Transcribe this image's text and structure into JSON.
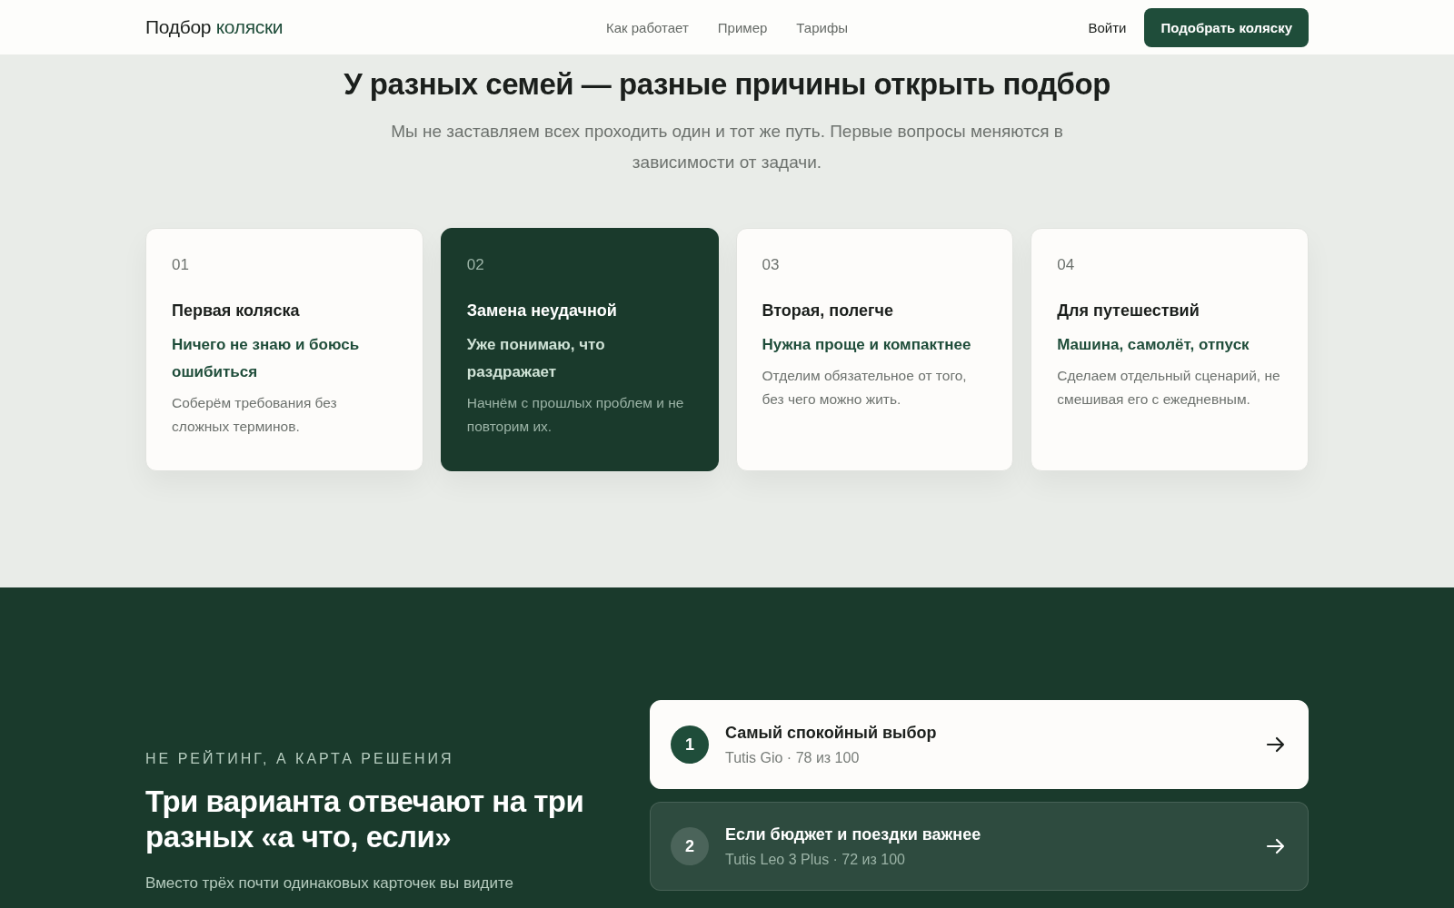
{
  "header": {
    "logo": {
      "part_1": "Подбор",
      "part_2": "коляски"
    },
    "nav": [
      "Как работает",
      "Пример",
      "Тарифы"
    ],
    "login": "Войти",
    "cta": "Подобрать коляску"
  },
  "situations": {
    "title": "У разных семей — разные причины открыть подбор",
    "subtitle": "Мы не заставляем всех проходить один и тот же путь. Первые вопросы меняются в зависимости от задачи.",
    "cards": [
      {
        "number": "01",
        "title": "Первая коляска",
        "quote": "Ничего не знаю и боюсь ошибиться",
        "text": "Соберём требования без сложных терминов.",
        "selected": false
      },
      {
        "number": "02",
        "title": "Замена неудачной",
        "quote": "Уже понимаю, что раздражает",
        "text": "Начнём с прошлых проблем и не повторим их.",
        "selected": true
      },
      {
        "number": "03",
        "title": "Вторая, полегче",
        "quote": "Нужна проще и компактнее",
        "text": "Отделим обязательное от того, без чего можно жить.",
        "selected": false
      },
      {
        "number": "04",
        "title": "Для путешествий",
        "quote": "Машина, самолёт, отпуск",
        "text": "Сделаем отдельный сценарий, не смешивая его с ежедневным.",
        "selected": false
      }
    ]
  },
  "decision": {
    "eyebrow": "НЕ РЕЙТИНГ, А КАРТА РЕШЕНИЯ",
    "title": "Три варианта отвечают на три разных «а что, если»",
    "text": "Вместо трёх почти одинаковых карточек вы видите",
    "options": [
      {
        "number": "1",
        "title": "Самый спокойный выбор",
        "detail": "Tutis Gio · 78 из 100",
        "selected": true
      },
      {
        "number": "2",
        "title": "Если бюджет и поездки важнее",
        "detail": "Tutis Leo 3 Plus · 72 из 100",
        "selected": false
      }
    ]
  }
}
